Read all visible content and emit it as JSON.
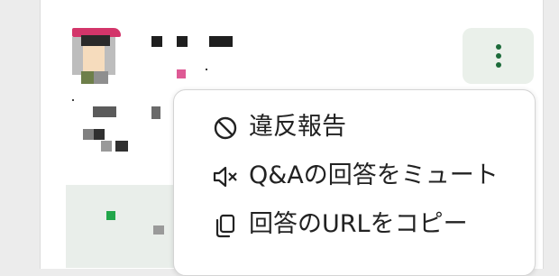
{
  "menu": {
    "items": [
      {
        "label": "違反報告",
        "icon": "block-icon"
      },
      {
        "label": "Q&Aの回答をミュート",
        "icon": "mute-icon"
      },
      {
        "label": "回答のURLをコピー",
        "icon": "copy-icon"
      }
    ]
  },
  "colors": {
    "accent_green": "#1c6b3a",
    "kebab_bg": "#eaf0ea",
    "menu_text": "#222222"
  }
}
